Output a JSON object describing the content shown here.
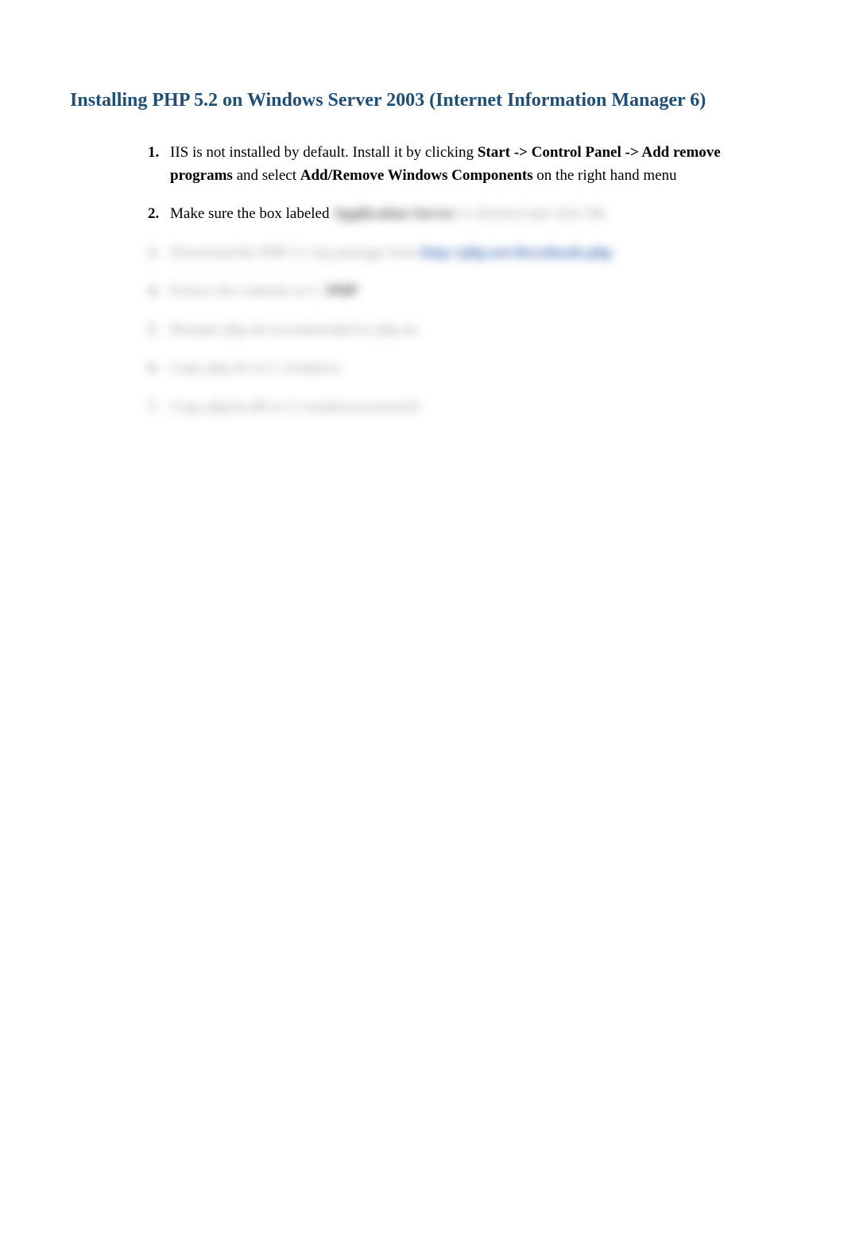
{
  "title": "Installing PHP 5.2 on Windows Server 2003 (Internet Information Manager 6)",
  "steps": [
    {
      "num": "1.",
      "segments": [
        {
          "text": "IIS is not installed by default. Install it by clicking ",
          "bold": false
        },
        {
          "text": "Start -> Control Panel -> Add remove programs",
          "bold": true
        },
        {
          "text": " and select ",
          "bold": false
        },
        {
          "text": "Add/Remove Windows Components",
          "bold": true
        },
        {
          "text": " on the right hand menu",
          "bold": false
        }
      ],
      "blurred": false
    },
    {
      "num": "2.",
      "segments": [
        {
          "text": "Make sure the box labeled ",
          "bold": false
        }
      ],
      "blurredTail": [
        {
          "text": "Application Server",
          "cls": "blur-dark bold"
        },
        {
          "text": " is checked and click OK",
          "cls": "blur-gray"
        }
      ],
      "blurred": false
    },
    {
      "num": "3.",
      "blurred": true,
      "blurredSegments": [
        {
          "text": "Download the PHP 5.2 zip package from ",
          "cls": "blur-gray"
        },
        {
          "text": "http://php.net/downloads.php",
          "cls": "blur-blue bold"
        }
      ]
    },
    {
      "num": "4.",
      "blurred": true,
      "blurredSegments": [
        {
          "text": "Extract the contents to C:\\",
          "cls": "blur-gray"
        },
        {
          "text": "PHP",
          "cls": "blur-dark bold"
        }
      ]
    },
    {
      "num": "5.",
      "blurred": true,
      "blurredSegments": [
        {
          "text": "Rename php.ini-recommended to php.ini",
          "cls": "blur-gray"
        }
      ]
    },
    {
      "num": "6.",
      "blurred": true,
      "blurredSegments": [
        {
          "text": "Copy php.ini to C:\\windows",
          "cls": "blur-gray"
        }
      ]
    },
    {
      "num": "7.",
      "blurred": true,
      "blurredSegments": [
        {
          "text": "Copy php5ts.dll to C:\\windows\\system32",
          "cls": "blur-gray"
        }
      ]
    }
  ]
}
